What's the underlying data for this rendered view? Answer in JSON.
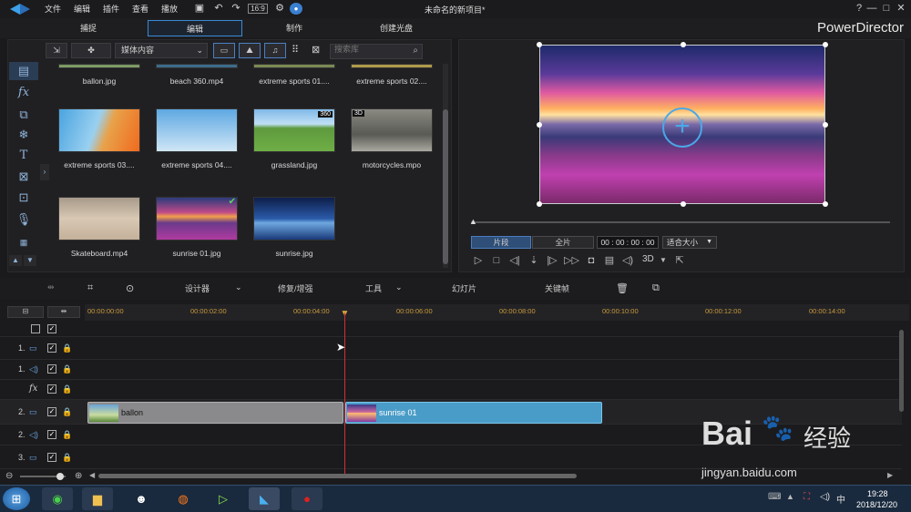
{
  "app": {
    "title": "未命名的新项目*",
    "brand": "PowerDirector"
  },
  "menu": [
    "文件",
    "编辑",
    "插件",
    "查看",
    "播放"
  ],
  "modes": [
    {
      "label": "捕捉"
    },
    {
      "label": "编辑"
    },
    {
      "label": "制作"
    },
    {
      "label": "创建光盘"
    }
  ],
  "window_controls": [
    "?",
    "—",
    "□",
    "✕"
  ],
  "library": {
    "dropdown": "媒体内容",
    "search_placeholder": "搜索库",
    "items": [
      {
        "label": "ballon.jpg"
      },
      {
        "label": "beach 360.mp4"
      },
      {
        "label": "extreme sports 01...."
      },
      {
        "label": "extreme sports 02...."
      },
      {
        "label": "extreme sports 03...."
      },
      {
        "label": "extreme sports 04...."
      },
      {
        "label": "grassland.jpg",
        "badge": "360"
      },
      {
        "label": "motorcycles.mpo",
        "badge": "3D"
      },
      {
        "label": "Skateboard.mp4"
      },
      {
        "label": "sunrise 01.jpg"
      },
      {
        "label": "sunrise.jpg"
      }
    ]
  },
  "preview": {
    "seg_clip": "片段",
    "seg_full": "全片",
    "timecode": "00 : 00 : 00 : 00",
    "fit": "适合大小",
    "label_3d": "3D"
  },
  "timeline_toolbar": {
    "designer": "设计器",
    "repair": "修复/增强",
    "tools": "工具",
    "slideshow": "幻灯片",
    "keyframe": "关键帧"
  },
  "ruler_ticks": [
    "00:00:00:00",
    "00:00:02:00",
    "00:00:04:00",
    "00:00:06:00",
    "00:00:08:00",
    "00:00:10:00",
    "00:00:12:00",
    "00:00:14:00"
  ],
  "tracks": [
    {
      "num": ""
    },
    {
      "num": "1."
    },
    {
      "num": "1."
    },
    {
      "num": ""
    },
    {
      "num": "2."
    },
    {
      "num": "2."
    },
    {
      "num": "3."
    }
  ],
  "clips": [
    {
      "label": "ballon"
    },
    {
      "label": "sunrise 01"
    }
  ],
  "taskbar": {
    "time": "19:28",
    "date": "2018/12/20"
  },
  "watermark": {
    "brand": "Bai",
    "brand2": "经验",
    "url": "jingyan.baidu.com"
  }
}
